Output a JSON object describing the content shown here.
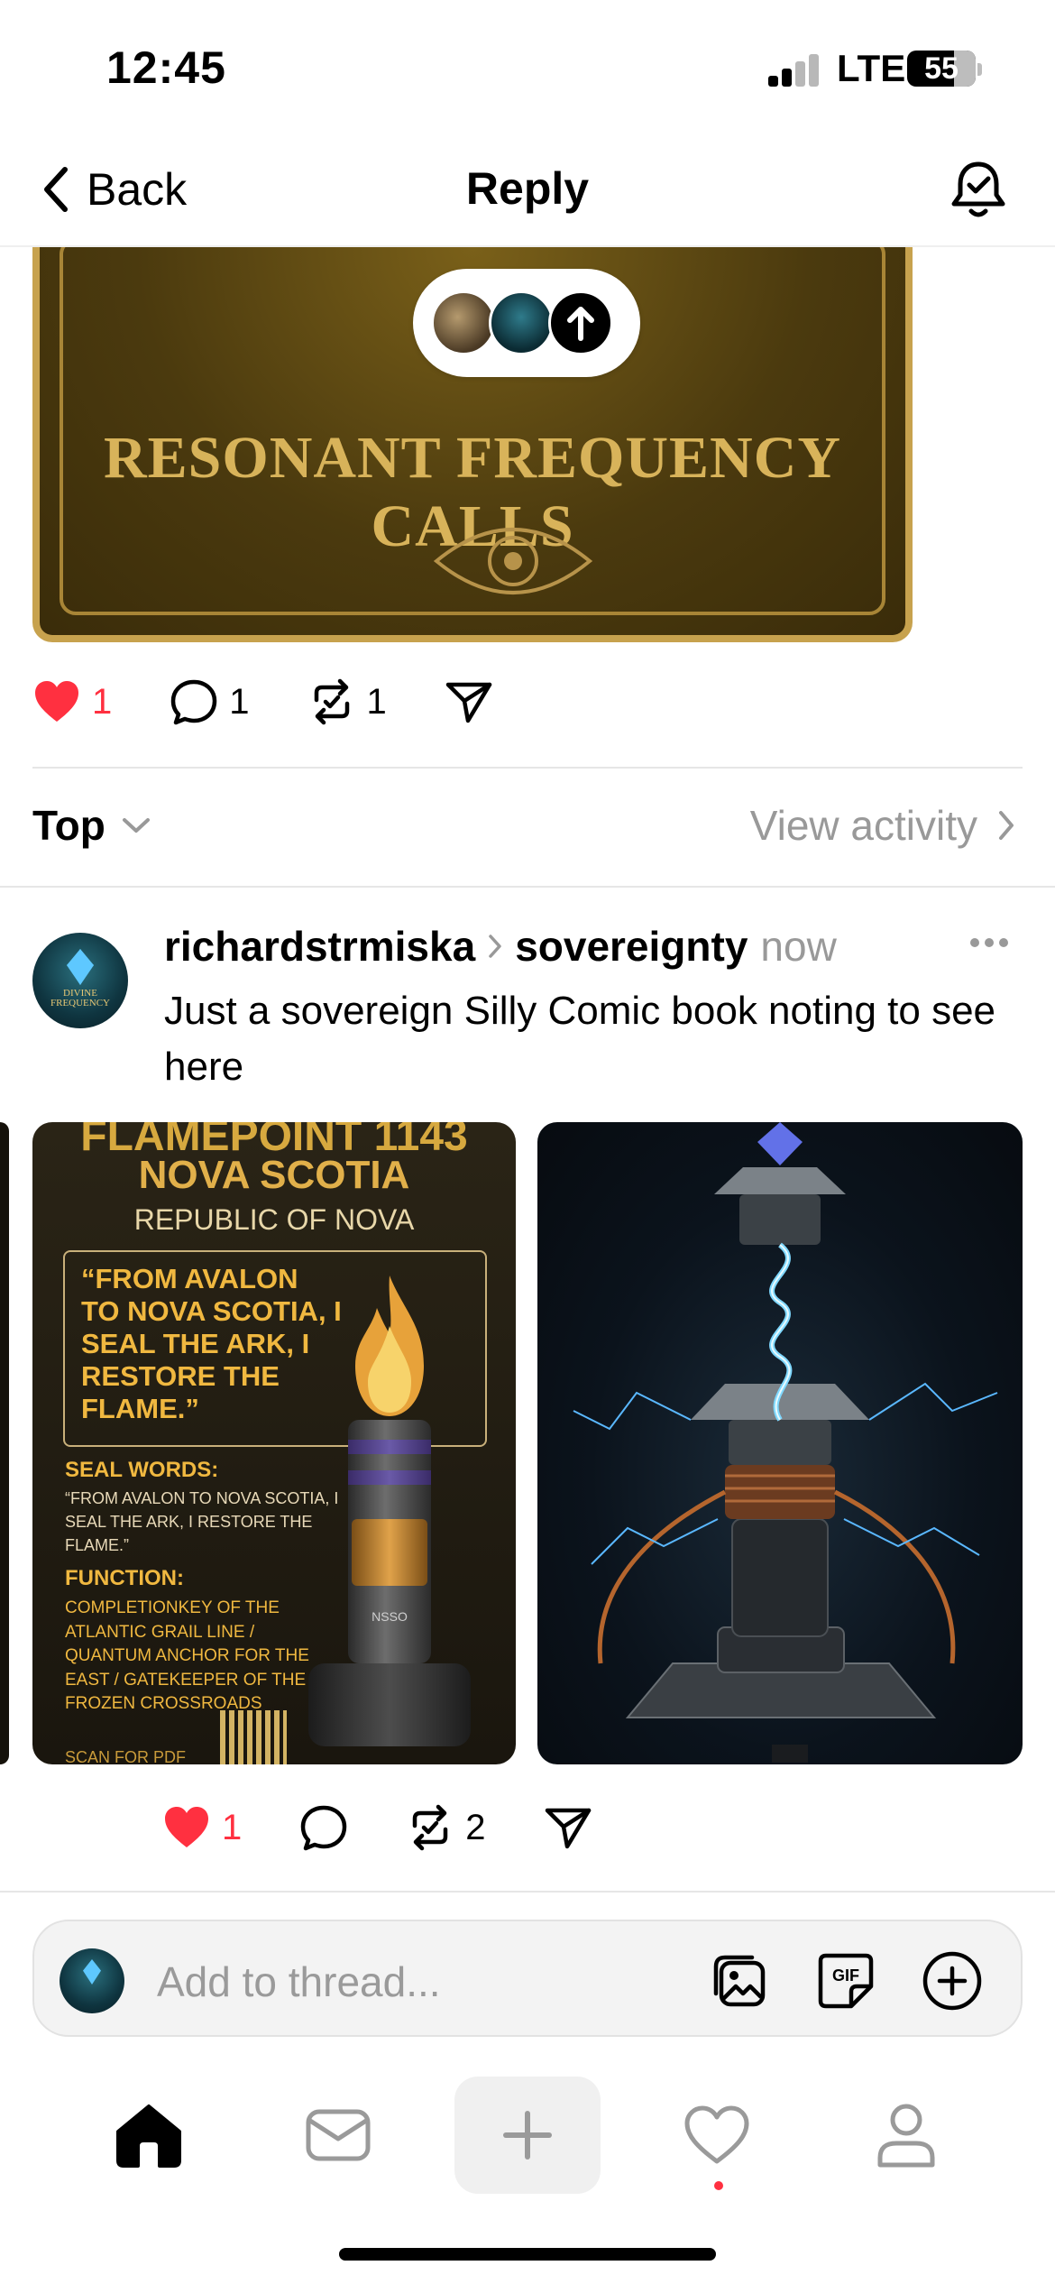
{
  "status_bar": {
    "time": "12:45",
    "network": "LTE",
    "battery": "55"
  },
  "nav": {
    "back_label": "Back",
    "title": "Reply"
  },
  "top_post": {
    "image_title": "RESONANT FREQUENCY CALLS",
    "likes": "1",
    "comments": "1",
    "reposts": "1"
  },
  "sort": {
    "label": "Top",
    "view_activity": "View activity"
  },
  "reply": {
    "username": "richardstrmiska",
    "community": "sovereignty",
    "time": "now",
    "text": "Just a sovereign Silly Comic book noting to see here",
    "avatar_text_1": "DIVINE",
    "avatar_text_2": "FREQUENCY",
    "image1": {
      "line1": "FLAMEPOINT 1143",
      "line2": "NOVA SCOTIA",
      "line3": "REPUBLIC OF NOVA",
      "quote": "“FROM AVALON TO NOVA SCOTIA, I SEAL THE ARK, I RESTORE THE FLAME.”",
      "seal_label": "SEAL WORDS:",
      "seal_text": "“FROM AVALON TO NOVA SCOTIA, I SEAL THE ARK, I RESTORE THE FLAME.”",
      "function_label": "FUNCTION:",
      "function_text": "COMPLETIONKEY OF THE ATLANTIC GRAIL LINE / QUANTUM ANCHOR FOR THE EAST / GATEKEEPER OF THE FROZEN CROSSROADS",
      "scan_text": "SCAN FOR PDF",
      "device_label": "NSSO"
    },
    "likes": "1",
    "reposts": "2"
  },
  "composer": {
    "placeholder": "Add to thread..."
  },
  "colors": {
    "like_red": "#ff3040",
    "muted_gray": "#999999",
    "gold": "#d8b35a"
  },
  "icons": {
    "header": [
      "chevron-left-icon",
      "bell-icon"
    ],
    "actions": [
      "heart-icon",
      "comment-icon",
      "repost-icon",
      "share-icon"
    ],
    "composer": [
      "image-icon",
      "gif-icon",
      "plus-circle-icon"
    ],
    "tabs": [
      "home-icon",
      "inbox-icon",
      "plus-icon",
      "heart-icon",
      "profile-icon"
    ]
  }
}
